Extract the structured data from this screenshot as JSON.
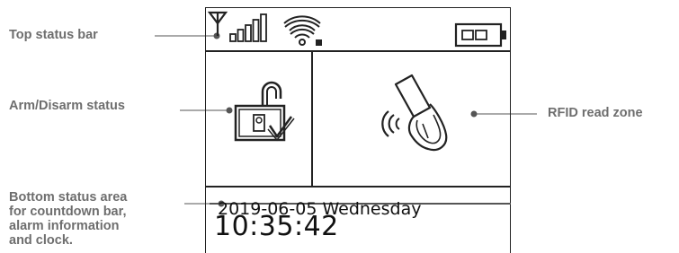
{
  "callouts": {
    "top_status": "Top status bar",
    "arm_disarm": "Arm/Disarm status",
    "rfid": "RFID read zone",
    "bottom_lines": [
      "Bottom status area",
      "for countdown bar,",
      "alarm information",
      "and clock."
    ]
  },
  "screen": {
    "date": "2019-06-05 Wednesday",
    "time": "10:35:42"
  },
  "icons": {
    "antenna": "antenna-icon",
    "signal": "signal-bars-icon",
    "wifi": "wifi-icon",
    "battery": "battery-icon",
    "lock": "open-padlock-check-icon",
    "rfid": "rfid-card-icon"
  },
  "colors": {
    "callout_text": "#6e6e6e",
    "screen_line": "#222222"
  }
}
